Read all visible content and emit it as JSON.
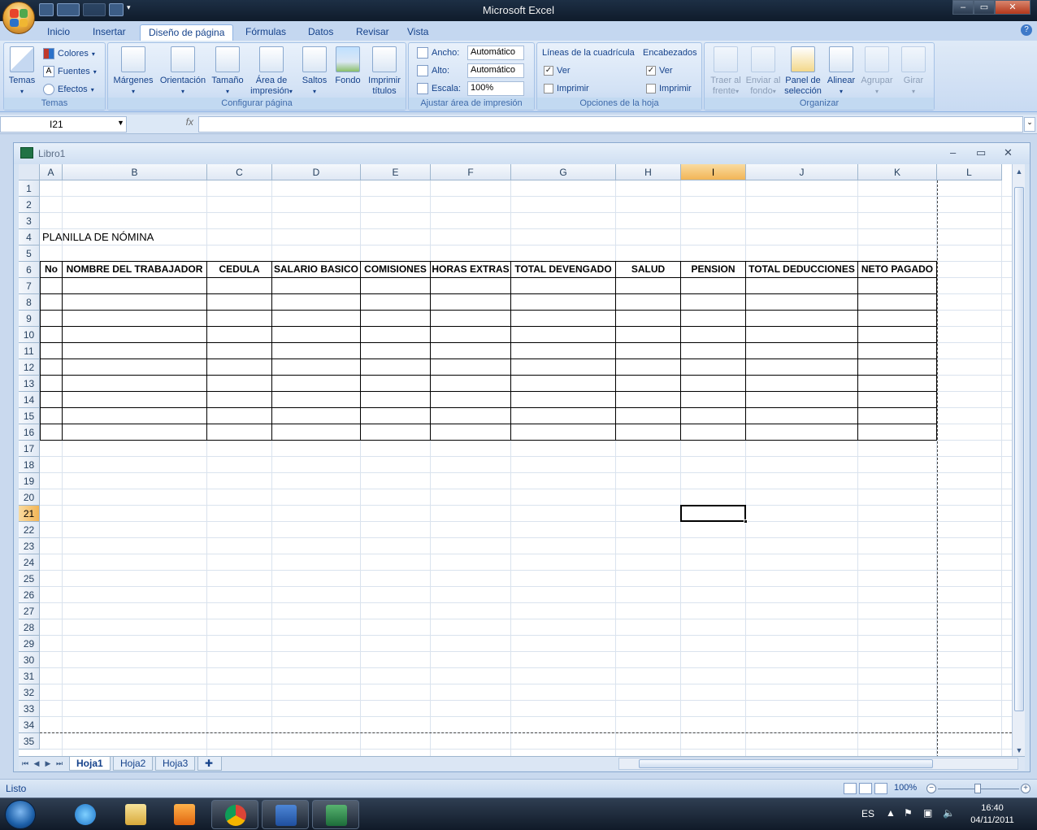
{
  "app": {
    "title": "Microsoft Excel",
    "window_controls": {
      "minimize": "‒",
      "maximize": "▭",
      "close": "✕"
    }
  },
  "ribbon": {
    "tabs": [
      {
        "label": "Inicio"
      },
      {
        "label": "Insertar"
      },
      {
        "label": "Diseño de página",
        "active": true
      },
      {
        "label": "Fórmulas"
      },
      {
        "label": "Datos"
      },
      {
        "label": "Revisar"
      },
      {
        "label": "Vista"
      }
    ],
    "help": "?",
    "temas": {
      "label": "Temas",
      "temas_button": "Temas",
      "colores": "Colores",
      "fuentes": "Fuentes",
      "efectos": "Efectos"
    },
    "configurar": {
      "label": "Configurar página",
      "margenes": "Márgenes",
      "orientacion": "Orientación",
      "tamano": "Tamaño",
      "area": [
        "Área de",
        "impresión"
      ],
      "saltos": "Saltos",
      "fondo": "Fondo",
      "imprimir_titulos": [
        "Imprimir",
        "títulos"
      ]
    },
    "ajustar": {
      "label": "Ajustar área de impresión",
      "ancho_label": "Ancho:",
      "ancho_value": "Automático",
      "alto_label": "Alto:",
      "alto_value": "Automático",
      "escala_label": "Escala:",
      "escala_value": "100%"
    },
    "opciones": {
      "label": "Opciones de la hoja",
      "lineas_title": "Líneas de la cuadrícula",
      "encabezados_title": "Encabezados",
      "ver": "Ver",
      "imprimir": "Imprimir",
      "lineas_ver_checked": true,
      "lineas_imprimir_checked": false,
      "enc_ver_checked": true,
      "enc_imprimir_checked": false
    },
    "organizar": {
      "label": "Organizar",
      "traer": [
        "Traer al",
        "frente"
      ],
      "enviar": [
        "Enviar al",
        "fondo"
      ],
      "panel": [
        "Panel de",
        "selección"
      ],
      "alinear": "Alinear",
      "agrupar": "Agrupar",
      "girar": "Girar"
    }
  },
  "formula_bar": {
    "name_box": "I21",
    "fx": "fx",
    "formula": ""
  },
  "workbook": {
    "title": "Libro1",
    "columns": [
      "A",
      "B",
      "C",
      "D",
      "E",
      "F",
      "G",
      "H",
      "I",
      "J",
      "K",
      "L"
    ],
    "selected_column": "I",
    "selected_row": 21,
    "rows": [
      1,
      2,
      3,
      4,
      5,
      6,
      7,
      8,
      9,
      10,
      11,
      12,
      13,
      14,
      15,
      16,
      17,
      18,
      19,
      20,
      21,
      22,
      23,
      24,
      25,
      26,
      27,
      28,
      29,
      30,
      31,
      32,
      33,
      34,
      35
    ],
    "cell_title": "PLANILLA DE NÓMINA",
    "table_headers": [
      "No",
      "NOMBRE DEL TRABAJADOR",
      "CEDULA",
      "SALARIO BASICO",
      "COMISIONES",
      "HORAS EXTRAS",
      "TOTAL DEVENGADO",
      "SALUD",
      "PENSION",
      "TOTAL DEDUCCIONES",
      "NETO PAGADO"
    ],
    "sheets": [
      {
        "name": "Hoja1",
        "active": true
      },
      {
        "name": "Hoja2"
      },
      {
        "name": "Hoja3"
      }
    ]
  },
  "status": {
    "text": "Listo",
    "zoom": "100%"
  },
  "taskbar": {
    "language": "ES",
    "time": "16:40",
    "date": "04/11/2011"
  },
  "colors": {
    "accent": "#15428b",
    "excel_green": "#207245",
    "selection_orange": "#f2b556"
  }
}
